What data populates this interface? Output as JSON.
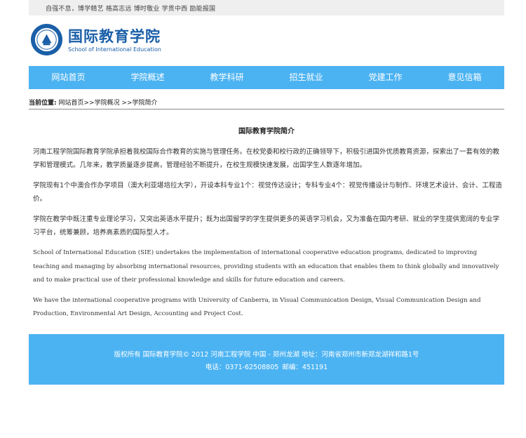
{
  "topbar": {
    "motto": "自强不息，博学精艺  格高志远  博时敬业  学贯中西  励能报国"
  },
  "header": {
    "title_cn": "国际教育学院",
    "title_en": "School of International Education",
    "brand_color": "#1a5fa8"
  },
  "nav": {
    "accent": "#4cb3f2",
    "items": [
      "网站首页",
      "学院概述",
      "教学科研",
      "招生就业",
      "党建工作",
      "意见信箱"
    ]
  },
  "breadcrumb": {
    "label": "当前位置:",
    "path": "网站首页>>学院概况  >>学院简介"
  },
  "article": {
    "title": "国际教育学院简介",
    "paragraphs": [
      "河南工程学院国际教育学院承担着我校国际合作教育的实施与管理任务。在校党委和校行政的正确领导下，积极引进国外优质教育资源，探索出了一套有效的教学和管理模式。几年来，教学质量逐步提高，管理经验不断提升，在校生规模快速发展，出国学生人数逐年增加。",
      "学院现有1个中澳合作办学项目（澳大利亚堪培拉大学），开设本科专业1个：视觉传达设计；专科专业4个：视觉传播设计与制作、环境艺术设计、会计、工程造价。",
      "学院在教学中既注重专业理论学习，又突出英语水平提升；既为出国留学的学生提供更多的英语学习机会，又为准备在国内考研、就业的学生提供宽阔的专业学习平台，统筹兼顾，培养高素质的国际型人才。"
    ],
    "paragraphs_en": [
      "School of International Education (SIE) undertakes the implementation of international cooperative education programs, dedicated to improving teaching and managing by absorbing international resources, providing students with an education that enables them to think globally and innovatively and to make practical use of their professional knowledge and skills for future education and careers.",
      "We have the international cooperative programs with University of Canberra, in Visual Communication Design, Visual Communication Design and Production, Environmental Art Design, Accounting and Project Cost."
    ]
  },
  "footer": {
    "line1": "版权所有  国际教育学院© 2012  河南工程学院  中国  -  郑州龙湖  地址：河南省郑州市新郑龙湖祥和路1号",
    "phone": "电话：0371-62508805",
    "postcode": "邮编：451191"
  }
}
